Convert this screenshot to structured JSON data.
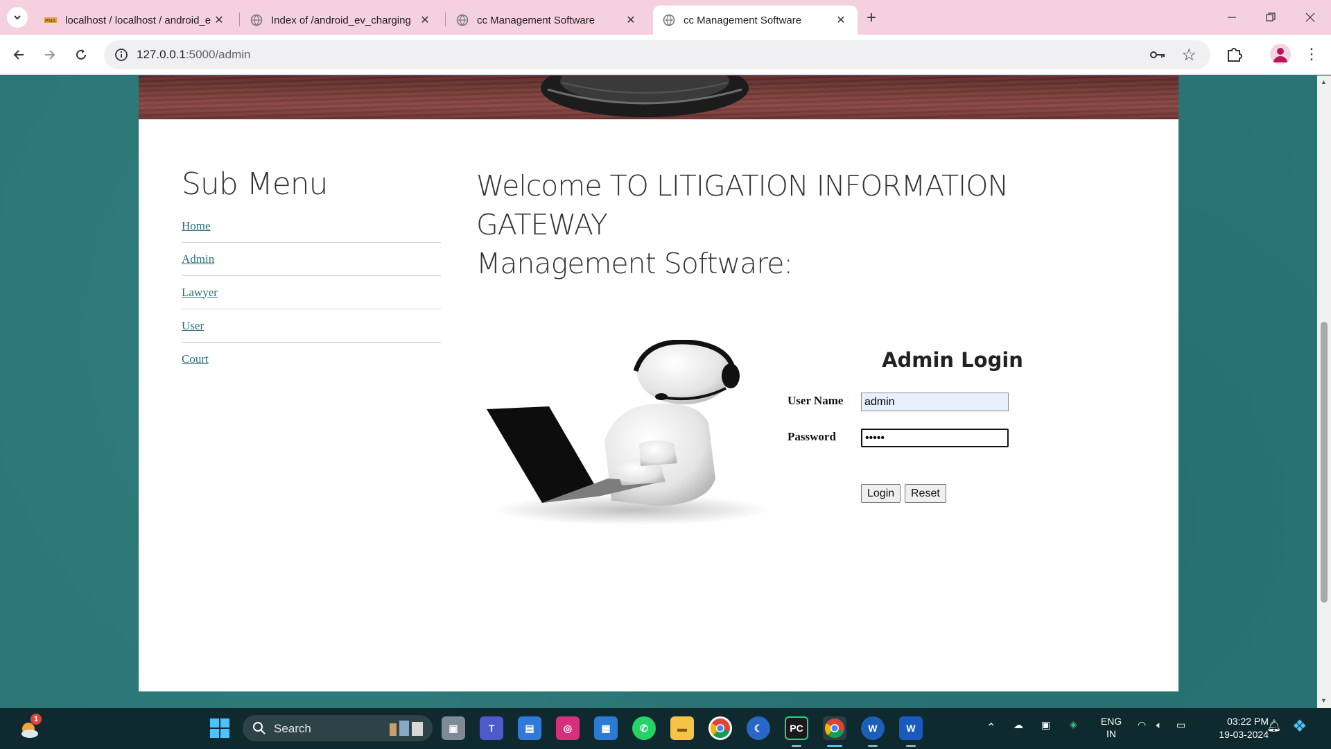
{
  "browser": {
    "tabs": [
      {
        "title": "localhost / localhost / android_e",
        "active": false
      },
      {
        "title": "Index of /android_ev_charging",
        "active": false
      },
      {
        "title": "cc Management Software",
        "active": false
      },
      {
        "title": "cc Management Software",
        "active": true
      }
    ],
    "address": {
      "host": "127.0.0.1",
      "path": ":5000/admin"
    }
  },
  "page": {
    "submenu_title": "Sub Menu",
    "submenu_items": [
      "Home",
      "Admin",
      "Lawyer",
      "User",
      "Court"
    ],
    "welcome_line1": "Welcome TO LITIGATION INFORMATION GATEWAY",
    "welcome_line2": "Management Software:",
    "login": {
      "title": "Admin Login",
      "username_label": "User Name",
      "username_value": "admin",
      "password_label": "Password",
      "password_value": "admin",
      "login_button": "Login",
      "reset_button": "Reset"
    }
  },
  "taskbar": {
    "weather_badge": "1",
    "search_placeholder": "Search",
    "language": "ENG",
    "region": "IN",
    "time": "03:22 PM",
    "date": "19-03-2024"
  },
  "colors": {
    "tab_bar": "#f5d0de",
    "page_background": "#2a7676",
    "link": "#2a6f7a",
    "taskbar": "#0f2a2e"
  }
}
